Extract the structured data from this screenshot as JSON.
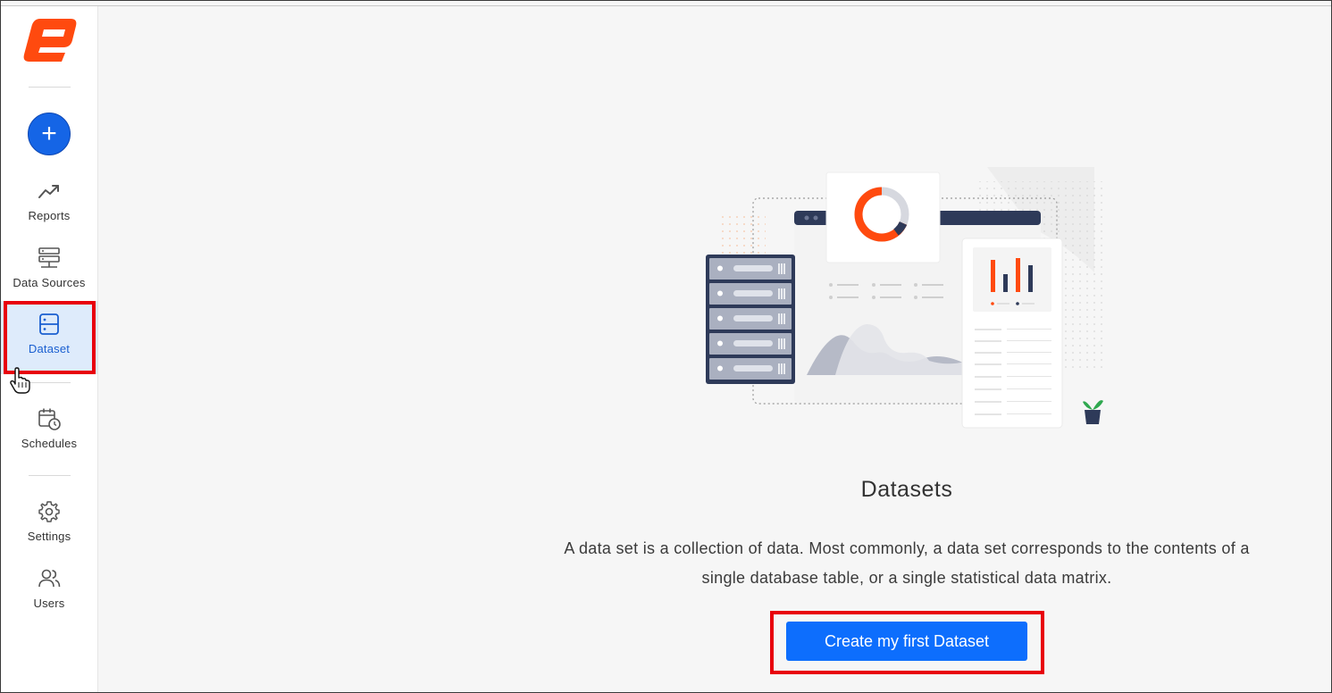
{
  "sidebar": {
    "logo_icon": "app-logo",
    "add_icon": "plus-icon",
    "add_label": "+",
    "items": [
      {
        "label": "Reports",
        "icon": "trending-up-icon"
      },
      {
        "label": "Data Sources",
        "icon": "server-stack-icon"
      },
      {
        "label": "Dataset",
        "icon": "dataset-icon",
        "active": true
      },
      {
        "label": "Schedules",
        "icon": "calendar-clock-icon"
      },
      {
        "label": "Settings",
        "icon": "gear-icon"
      },
      {
        "label": "Users",
        "icon": "users-icon"
      }
    ]
  },
  "main": {
    "title": "Datasets",
    "description_line1": "A data set is a collection of data. Most commonly, a data set corresponds to the contents of a",
    "description_line2": "single database table, or a single statistical data matrix.",
    "cta_label": "Create my first Dataset"
  },
  "colors": {
    "brand_orange": "#ff4a0f",
    "primary_blue": "#0d6efd",
    "active_bg": "#deebfb",
    "highlight_red": "#e8000b",
    "navy": "#2e3a59"
  }
}
